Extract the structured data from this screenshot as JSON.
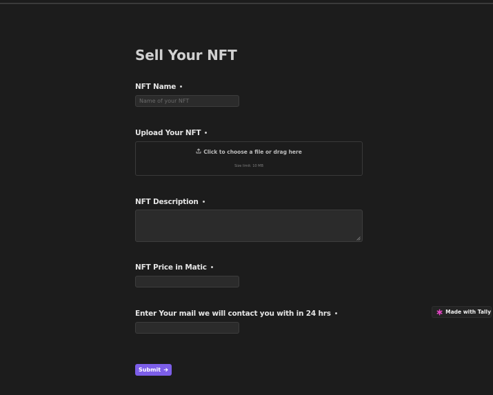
{
  "form": {
    "title": "Sell Your NFT",
    "fields": {
      "nft_name": {
        "label": "NFT Name",
        "placeholder": "Name of your NFT",
        "value": ""
      },
      "upload": {
        "label": "Upload Your NFT",
        "prompt": "Click to choose a file or drag here",
        "size_limit": "Size limit: 10 MB",
        "icon": "upload-icon"
      },
      "description": {
        "label": "NFT Description",
        "value": ""
      },
      "price": {
        "label": "NFT Price in Matic",
        "value": ""
      },
      "email": {
        "label": "Enter Your mail we will contact you with in 24 hrs",
        "value": ""
      }
    },
    "submit": {
      "label": "Submit",
      "icon": "arrow-right-icon"
    }
  },
  "badge": {
    "label": "Made with Tally",
    "icon": "tally-asterisk-icon"
  },
  "colors": {
    "background": "#1c1c1c",
    "input_background": "#2b2b2b",
    "accent": "#7c5ee8",
    "badge_icon": "#e845c8"
  }
}
